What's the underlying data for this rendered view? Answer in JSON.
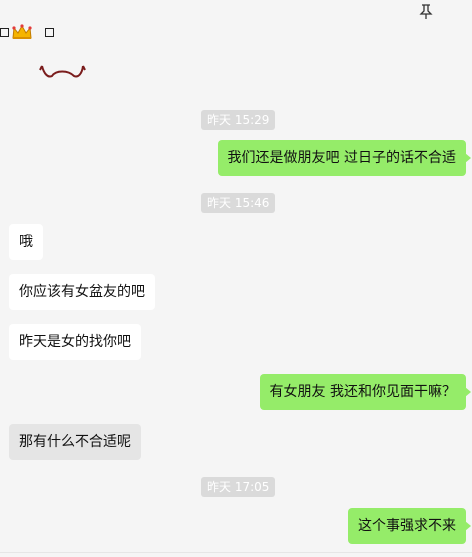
{
  "window": {
    "title_prefix_box": "",
    "title_suffix_box": "",
    "crown_icon": "crown-emoji",
    "pin_icon": "pin-icon",
    "close_icon": "close-icon",
    "close_glyph": "□"
  },
  "messages": [
    {
      "kind": "timestamp",
      "text": "昨天 15:29"
    },
    {
      "kind": "outgoing",
      "text": "我们还是做朋友吧   过日子的话不合适"
    },
    {
      "kind": "timestamp",
      "text": "昨天 15:46"
    },
    {
      "kind": "incoming",
      "text": "哦"
    },
    {
      "kind": "incoming",
      "text": "你应该有女盆友的吧"
    },
    {
      "kind": "incoming",
      "text": "昨天是女的找你吧"
    },
    {
      "kind": "outgoing",
      "text": "有女朋友  我还和你见面干嘛？"
    },
    {
      "kind": "incoming",
      "text": "那有什么不合适呢"
    },
    {
      "kind": "timestamp",
      "text": "昨天 17:05"
    },
    {
      "kind": "outgoing",
      "text": "这个事强求不来"
    }
  ],
  "colors": {
    "background": "#f5f5f5",
    "outgoing_bubble": "#95ec69",
    "incoming_bubble": "#ffffff",
    "timestamp_bg": "#dadada"
  }
}
